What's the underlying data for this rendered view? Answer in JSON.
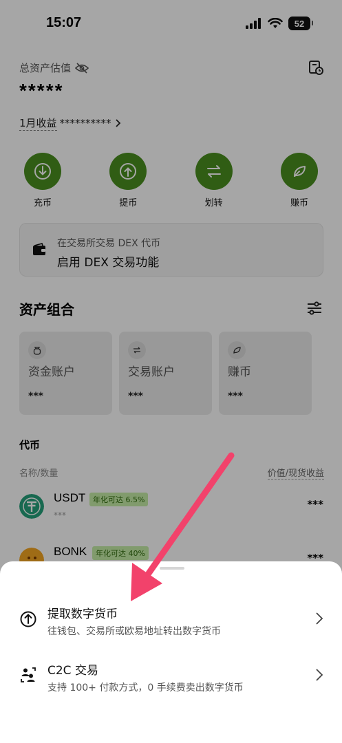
{
  "status_bar": {
    "time": "15:07",
    "battery": "52"
  },
  "assets": {
    "label": "总资产估值",
    "value": "*****",
    "income_label": "1月收益",
    "income_value": "**********"
  },
  "actions": [
    {
      "label": "充币",
      "icon": "deposit-icon"
    },
    {
      "label": "提币",
      "icon": "withdraw-icon"
    },
    {
      "label": "划转",
      "icon": "transfer-icon"
    },
    {
      "label": "赚币",
      "icon": "earn-icon"
    }
  ],
  "dex_card": {
    "title": "在交易所交易 DEX 代币",
    "subtitle": "启用 DEX 交易功能"
  },
  "portfolio": {
    "title": "资产组合",
    "accounts": [
      {
        "name": "资金账户",
        "value": "***"
      },
      {
        "name": "交易账户",
        "value": "***"
      },
      {
        "name": "赚币",
        "value": "***"
      }
    ]
  },
  "tokens": {
    "title": "代币",
    "col_left": "名称/数量",
    "col_right": "价值/现货收益",
    "items": [
      {
        "name": "USDT",
        "badge": "年化可达 6.5%",
        "amount": "***",
        "value": "***"
      },
      {
        "name": "BONK",
        "badge": "年化可达 40%",
        "amount": "",
        "value": "***"
      }
    ]
  },
  "sheet": {
    "items": [
      {
        "title": "提取数字货币",
        "subtitle": "往钱包、交易所或欧易地址转出数字货币"
      },
      {
        "title": "C2C 交易",
        "subtitle": "支持 100+ 付款方式，0 手续费卖出数字货币"
      }
    ]
  },
  "colors": {
    "accent_green": "#4b8f20",
    "badge_bg": "#c7eea8",
    "arrow": "#f2426b"
  }
}
